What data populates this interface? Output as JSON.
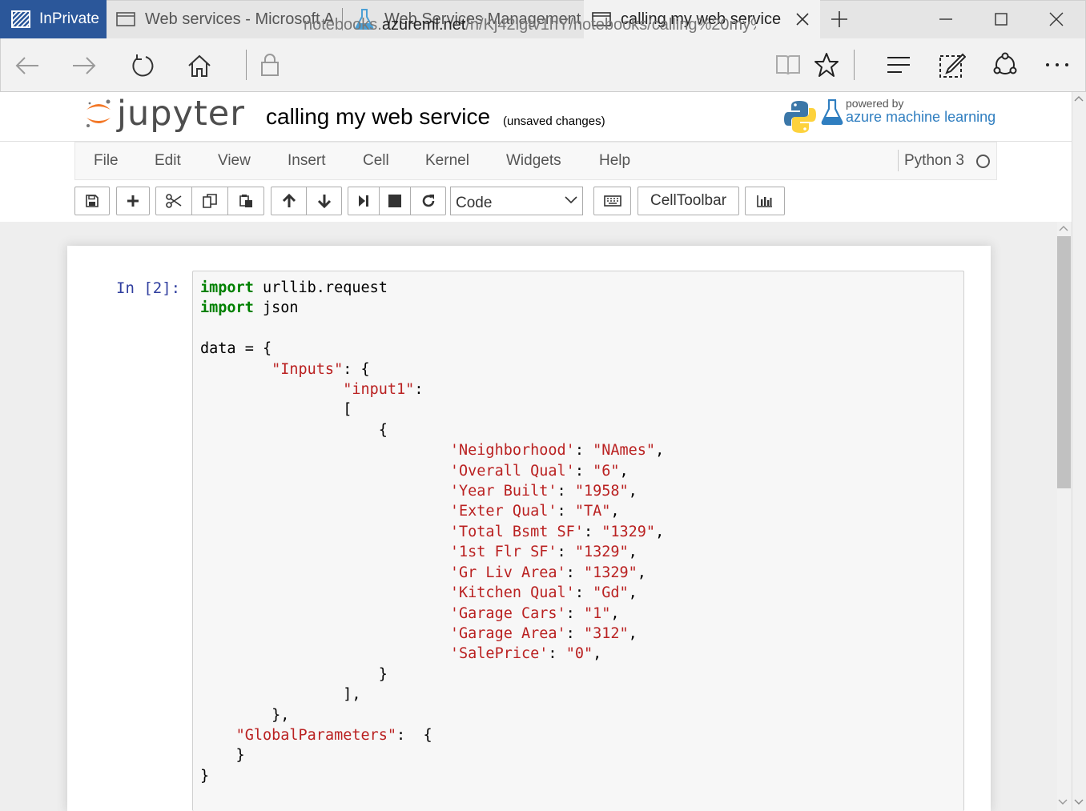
{
  "browser": {
    "inprivate_label": "InPrivate",
    "tabs": [
      {
        "title": "Web services - Microsoft A",
        "icon": "page-icon"
      },
      {
        "title": "Web Services Management",
        "icon": "flask-icon"
      },
      {
        "title": "calling my web service",
        "icon": "page-icon",
        "active": true
      }
    ],
    "url_prefix": "notebooks.",
    "url_domain": "azureml.net",
    "url_path": "/n/Kj42lgtv1hY/notebooks/calling%20my%"
  },
  "jupyter": {
    "logo_text": "jupyter",
    "notebook_title": "calling my web service",
    "save_status": "(unsaved changes)",
    "powered_by": "powered by",
    "brand": "azure machine learning",
    "menu": [
      "File",
      "Edit",
      "View",
      "Insert",
      "Cell",
      "Kernel",
      "Widgets",
      "Help"
    ],
    "kernel_name": "Python 3",
    "toolbar": {
      "cell_type": "Code",
      "celltoolbar_label": "CellToolbar"
    }
  },
  "cell": {
    "prompt": "In [2]:",
    "lines": [
      [
        {
          "t": "import",
          "c": "kw"
        },
        {
          "t": " urllib.request"
        }
      ],
      [
        {
          "t": "import",
          "c": "kw"
        },
        {
          "t": " json"
        }
      ],
      [
        {
          "t": ""
        }
      ],
      [
        {
          "t": "data = {"
        }
      ],
      [
        {
          "t": "        "
        },
        {
          "t": "\"Inputs\"",
          "c": "st"
        },
        {
          "t": ": {"
        }
      ],
      [
        {
          "t": "                "
        },
        {
          "t": "\"input1\"",
          "c": "st"
        },
        {
          "t": ":"
        }
      ],
      [
        {
          "t": "                ["
        }
      ],
      [
        {
          "t": "                    {"
        }
      ],
      [
        {
          "t": "                            "
        },
        {
          "t": "'Neighborhood'",
          "c": "st"
        },
        {
          "t": ": "
        },
        {
          "t": "\"NAmes\"",
          "c": "st"
        },
        {
          "t": ","
        }
      ],
      [
        {
          "t": "                            "
        },
        {
          "t": "'Overall Qual'",
          "c": "st"
        },
        {
          "t": ": "
        },
        {
          "t": "\"6\"",
          "c": "st"
        },
        {
          "t": ","
        }
      ],
      [
        {
          "t": "                            "
        },
        {
          "t": "'Year Built'",
          "c": "st"
        },
        {
          "t": ": "
        },
        {
          "t": "\"1958\"",
          "c": "st"
        },
        {
          "t": ","
        }
      ],
      [
        {
          "t": "                            "
        },
        {
          "t": "'Exter Qual'",
          "c": "st"
        },
        {
          "t": ": "
        },
        {
          "t": "\"TA\"",
          "c": "st"
        },
        {
          "t": ","
        }
      ],
      [
        {
          "t": "                            "
        },
        {
          "t": "'Total Bsmt SF'",
          "c": "st"
        },
        {
          "t": ": "
        },
        {
          "t": "\"1329\"",
          "c": "st"
        },
        {
          "t": ","
        }
      ],
      [
        {
          "t": "                            "
        },
        {
          "t": "'1st Flr SF'",
          "c": "st"
        },
        {
          "t": ": "
        },
        {
          "t": "\"1329\"",
          "c": "st"
        },
        {
          "t": ","
        }
      ],
      [
        {
          "t": "                            "
        },
        {
          "t": "'Gr Liv Area'",
          "c": "st"
        },
        {
          "t": ": "
        },
        {
          "t": "\"1329\"",
          "c": "st"
        },
        {
          "t": ","
        }
      ],
      [
        {
          "t": "                            "
        },
        {
          "t": "'Kitchen Qual'",
          "c": "st"
        },
        {
          "t": ": "
        },
        {
          "t": "\"Gd\"",
          "c": "st"
        },
        {
          "t": ","
        }
      ],
      [
        {
          "t": "                            "
        },
        {
          "t": "'Garage Cars'",
          "c": "st"
        },
        {
          "t": ": "
        },
        {
          "t": "\"1\"",
          "c": "st"
        },
        {
          "t": ","
        }
      ],
      [
        {
          "t": "                            "
        },
        {
          "t": "'Garage Area'",
          "c": "st"
        },
        {
          "t": ": "
        },
        {
          "t": "\"312\"",
          "c": "st"
        },
        {
          "t": ","
        }
      ],
      [
        {
          "t": "                            "
        },
        {
          "t": "'SalePrice'",
          "c": "st"
        },
        {
          "t": ": "
        },
        {
          "t": "\"0\"",
          "c": "st"
        },
        {
          "t": ","
        }
      ],
      [
        {
          "t": "                    }"
        }
      ],
      [
        {
          "t": "                ],"
        }
      ],
      [
        {
          "t": "        },"
        }
      ],
      [
        {
          "t": "    "
        },
        {
          "t": "\"GlobalParameters\"",
          "c": "st"
        },
        {
          "t": ":  {"
        }
      ],
      [
        {
          "t": "    }"
        }
      ],
      [
        {
          "t": "}"
        }
      ]
    ]
  }
}
